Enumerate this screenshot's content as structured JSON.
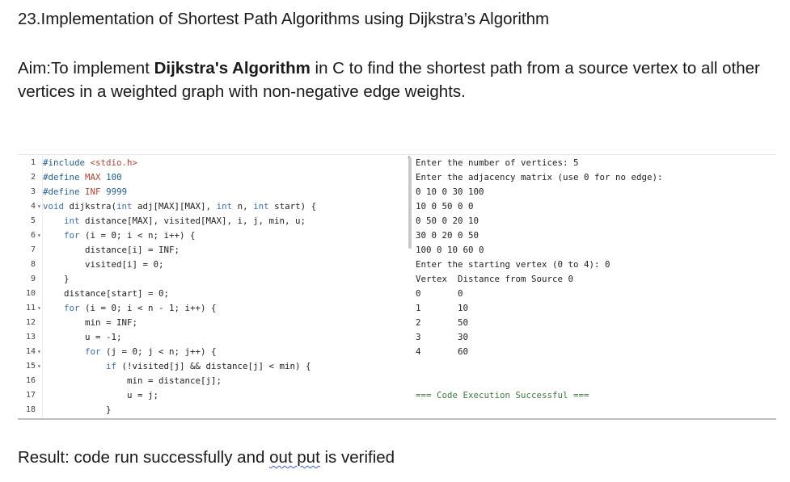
{
  "heading": "23.Implementation of Shortest Path Algorithms using Dijkstra’s Algorithm",
  "aim": {
    "prefix": "Aim:To implement ",
    "bold": "Dijkstra's Algorithm",
    "suffix": " in C to find the shortest path from a source vertex to all other vertices in a weighted graph with non-negative edge weights."
  },
  "editor": {
    "lines": [
      {
        "n": "1",
        "fold": "",
        "code": "#include <stdio.h>"
      },
      {
        "n": "2",
        "fold": "",
        "code": "#define MAX 100"
      },
      {
        "n": "3",
        "fold": "",
        "code": "#define INF 9999"
      },
      {
        "n": "4",
        "fold": "▾",
        "code": "void dijkstra(int adj[MAX][MAX], int n, int start) {"
      },
      {
        "n": "5",
        "fold": "",
        "code": "    int distance[MAX], visited[MAX], i, j, min, u;"
      },
      {
        "n": "6",
        "fold": "▾",
        "code": "    for (i = 0; i < n; i++) {"
      },
      {
        "n": "7",
        "fold": "",
        "code": "        distance[i] = INF;"
      },
      {
        "n": "8",
        "fold": "",
        "code": "        visited[i] = 0;"
      },
      {
        "n": "9",
        "fold": "",
        "code": "    }"
      },
      {
        "n": "10",
        "fold": "",
        "code": "    distance[start] = 0;"
      },
      {
        "n": "11",
        "fold": "▾",
        "code": "    for (i = 0; i < n - 1; i++) {"
      },
      {
        "n": "12",
        "fold": "",
        "code": "        min = INF;"
      },
      {
        "n": "13",
        "fold": "",
        "code": "        u = -1;"
      },
      {
        "n": "14",
        "fold": "▾",
        "code": "        for (j = 0; j < n; j++) {"
      },
      {
        "n": "15",
        "fold": "▾",
        "code": "            if (!visited[j] && distance[j] < min) {"
      },
      {
        "n": "16",
        "fold": "",
        "code": "                min = distance[j];"
      },
      {
        "n": "17",
        "fold": "",
        "code": "                u = j;"
      },
      {
        "n": "18",
        "fold": "",
        "code": "            }"
      }
    ]
  },
  "console": {
    "lines": [
      "Enter the number of vertices: 5",
      "Enter the adjacency matrix (use 0 for no edge):",
      "0 10 0 30 100",
      "10 0 50 0 0",
      "0 50 0 20 10",
      "30 0 20 0 50",
      "100 0 10 60 0",
      "Enter the starting vertex (0 to 4): 0",
      "Vertex  Distance from Source 0",
      "0       0",
      "1       10",
      "2       50",
      "3       30",
      "4       60",
      "",
      "",
      "=== Code Execution Successful ==="
    ]
  },
  "result": {
    "prefix": "Result: code run successfully and ",
    "squiggled": "out put",
    "suffix": " is verified"
  }
}
